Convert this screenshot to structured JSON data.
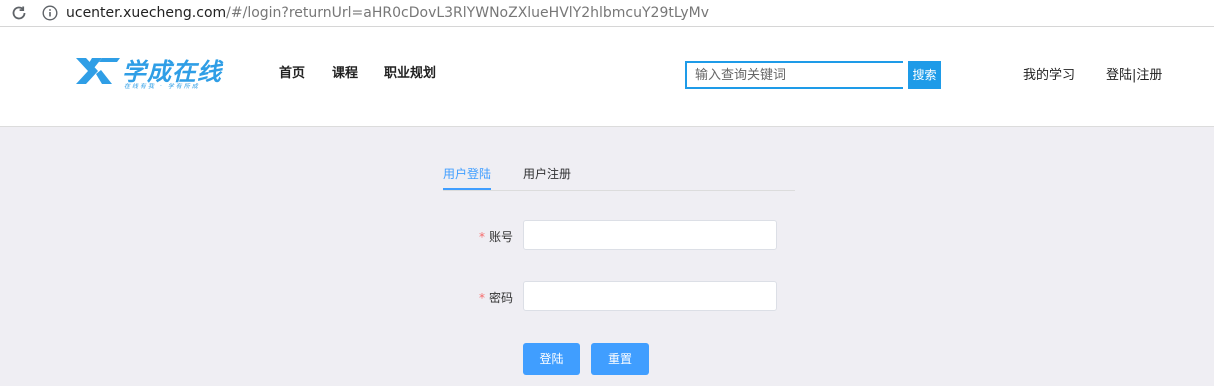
{
  "browser": {
    "url_host": "ucenter.xuecheng.com",
    "url_rest": "/#/login?returnUrl=aHR0cDovL3RlYWNoZXlueHVlY2hlbmcuY29tLyMv"
  },
  "header": {
    "logo_text": "学成在线",
    "logo_slogan": "在线有我 · 学有所成",
    "nav": [
      "首页",
      "课程",
      "职业规划"
    ],
    "search_placeholder": "输入查询关键词",
    "search_button": "搜索",
    "my_learning": "我的学习",
    "login_register": "登陆|注册"
  },
  "login": {
    "tabs": [
      "用户登陆",
      "用户注册"
    ],
    "active_tab": "用户登陆",
    "account_label": "账号",
    "password_label": "密码",
    "account_value": "",
    "password_value": "",
    "required_mark": "*",
    "login_button": "登陆",
    "reset_button": "重置"
  },
  "colors": {
    "brand": "#1e9be8",
    "primary": "#409eff",
    "required": "#f56c6c",
    "page_bg": "#efeef3"
  }
}
